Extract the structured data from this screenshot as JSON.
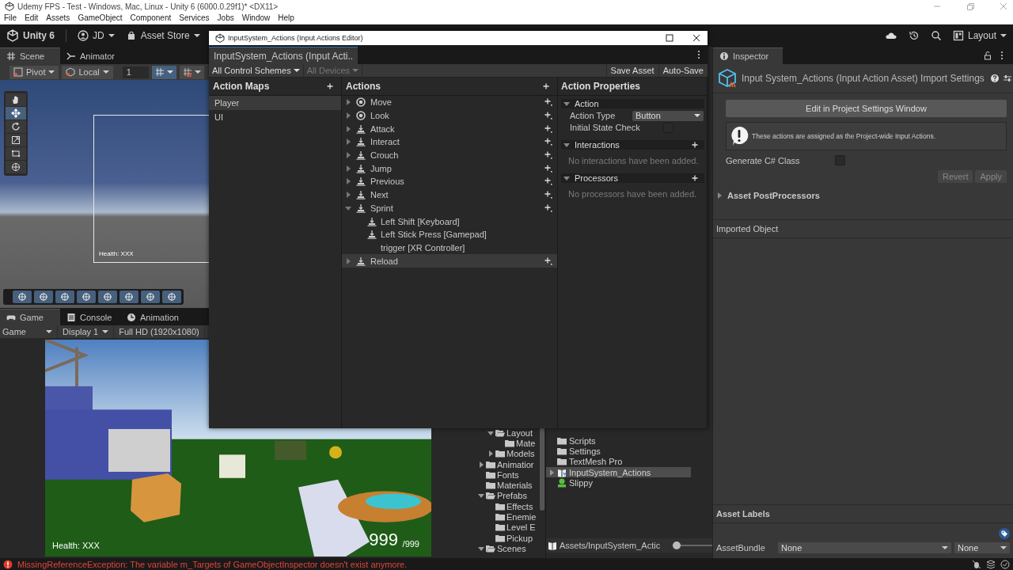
{
  "window": {
    "title": "Udemy FPS - Test - Windows, Mac, Linux - Unity 6 (6000.0.29f1)* <DX11>"
  },
  "menu": [
    "File",
    "Edit",
    "Assets",
    "GameObject",
    "Component",
    "Services",
    "Jobs",
    "Window",
    "Help"
  ],
  "toolbar": {
    "unity": "Unity 6",
    "account": "JD",
    "asset_store": "Asset Store",
    "layout": "Layout"
  },
  "scene": {
    "tabs": [
      {
        "label": "Scene",
        "selected": true
      },
      {
        "label": "Animator",
        "selected": false
      }
    ],
    "pivot": "Pivot",
    "space": "Local",
    "grid_size": "1",
    "tools": [
      {
        "kind": "hand",
        "selected": false
      },
      {
        "kind": "move",
        "selected": true
      },
      {
        "kind": "rotate",
        "selected": false
      },
      {
        "kind": "scale",
        "selected": false
      },
      {
        "kind": "rect",
        "selected": false
      },
      {
        "kind": "transform",
        "selected": false
      }
    ],
    "hud": "Health: XXX"
  },
  "game": {
    "tabs": [
      {
        "label": "Game",
        "selected": true
      },
      {
        "label": "Console",
        "selected": false
      },
      {
        "label": "Animation",
        "selected": false
      }
    ],
    "view": "Game",
    "display": "Display 1",
    "resolution": "Full HD (1920x1080)",
    "health": "Health: XXX",
    "ammo": "999",
    "ammo_max": "/999"
  },
  "editor": {
    "title": "InputSystem_Actions (Input Actions Editor)",
    "tab": "InputSystem_Actions (Input Acti..",
    "control_schemes": "All Control Schemes",
    "devices": "All Devices",
    "devices_disabled": true,
    "save": "Save Asset",
    "auto_save": "Auto-Save",
    "maps_title": "Action Maps",
    "maps": [
      {
        "name": "Player",
        "selected": true
      },
      {
        "name": "UI",
        "selected": false
      }
    ],
    "actions_title": "Actions",
    "actions": [
      {
        "name": "Move",
        "kind": "value",
        "expanded": false,
        "selected": false
      },
      {
        "name": "Look",
        "kind": "value",
        "expanded": false,
        "selected": false
      },
      {
        "name": "Attack",
        "kind": "button",
        "expanded": false,
        "selected": false
      },
      {
        "name": "Interact",
        "kind": "button",
        "expanded": false,
        "selected": false
      },
      {
        "name": "Crouch",
        "kind": "button",
        "expanded": false,
        "selected": false
      },
      {
        "name": "Jump",
        "kind": "button",
        "expanded": false,
        "selected": false
      },
      {
        "name": "Previous",
        "kind": "button",
        "expanded": false,
        "selected": false
      },
      {
        "name": "Next",
        "kind": "button",
        "expanded": false,
        "selected": false
      },
      {
        "name": "Sprint",
        "kind": "button",
        "expanded": true,
        "selected": false,
        "bindings": [
          {
            "name": "Left Shift [Keyboard]",
            "kind": "button"
          },
          {
            "name": "Left Stick Press [Gamepad]",
            "kind": "button"
          },
          {
            "name": "trigger [XR Controller]",
            "kind": "none"
          }
        ]
      },
      {
        "name": "Reload",
        "kind": "button",
        "expanded": false,
        "selected": true
      }
    ],
    "props_title": "Action Properties",
    "action_section": "Action",
    "action_type_label": "Action Type",
    "action_type": "Button",
    "initial_state_label": "Initial State Check",
    "initial_state_checked": false,
    "sections": [
      {
        "title": "Interactions",
        "empty": "No interactions have been added."
      },
      {
        "title": "Processors",
        "empty": "No processors have been added."
      }
    ]
  },
  "project": {
    "tree": [
      {
        "expanded": true,
        "children": [
          {
            "name": "Layout",
            "expanded": true,
            "children": [
              {
                "name": "Mate"
              }
            ]
          },
          {
            "name": "Models",
            "expanded": false
          }
        ]
      },
      {
        "name": "Animatior",
        "expanded": false
      },
      {
        "name": "Fonts"
      },
      {
        "name": "Materials"
      },
      {
        "name": "Prefabs",
        "expanded": true,
        "children": [
          {
            "name": "Effects"
          },
          {
            "name": "Enemie"
          },
          {
            "name": "Level E"
          },
          {
            "name": "Pickup"
          }
        ]
      },
      {
        "name": "Scenes",
        "expanded": true
      }
    ],
    "assets": [
      {
        "name": "Scripts",
        "kind": "folder",
        "selected": false
      },
      {
        "name": "Settings",
        "kind": "folder",
        "selected": false
      },
      {
        "name": "TextMesh Pro",
        "kind": "folder",
        "selected": false
      },
      {
        "name": "InputSystem_Actions",
        "kind": "actions",
        "selected": true
      },
      {
        "name": "Slippy",
        "kind": "prefab",
        "selected": false
      }
    ],
    "path": "Assets/InputSystem_Actic",
    "zoom": {
      "level": 0.05
    }
  },
  "inspector": {
    "tab": "Inspector",
    "title": "Input System_Actions (Input Action Asset) Import Settings",
    "edit_button": "Edit in Project Settings Window",
    "help": "These actions are assigned as the Project-wide Input Actions.",
    "generate_label": "Generate C# Class",
    "generate_checked": false,
    "revert": "Revert",
    "apply": "Apply",
    "buttons_disabled": true,
    "postprocessors": {
      "label": "Asset PostProcessors",
      "expanded": false
    },
    "imported_object": "Imported Object",
    "asset_labels": "Asset Labels",
    "asset_bundle_label": "AssetBundle",
    "asset_bundle": "None",
    "variant": "None"
  },
  "status": {
    "error": "MissingReferenceException: The variable m_Targets of GameObjectInspector doesn't exist anymore."
  }
}
